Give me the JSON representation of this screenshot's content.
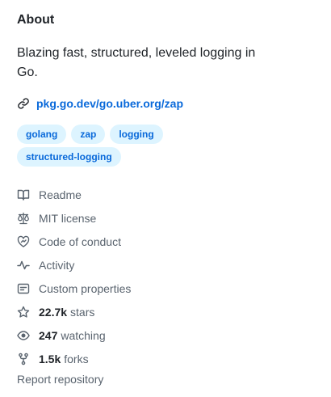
{
  "about": {
    "title": "About",
    "description": "Blazing fast, structured, leveled logging in Go.",
    "homepage": "pkg.go.dev/go.uber.org/zap",
    "topics": [
      "golang",
      "zap",
      "logging",
      "structured-logging"
    ]
  },
  "meta": {
    "readme": "Readme",
    "license": "MIT license",
    "code_of_conduct": "Code of conduct",
    "activity": "Activity",
    "custom_properties": "Custom properties",
    "stars_count": "22.7k",
    "stars_label": "stars",
    "watching_count": "247",
    "watching_label": "watching",
    "forks_count": "1.5k",
    "forks_label": "forks"
  },
  "report_label": "Report repository",
  "colors": {
    "link": "#0969da",
    "topic_bg": "#ddf4ff",
    "muted": "#59636e",
    "text": "#1f2328"
  }
}
